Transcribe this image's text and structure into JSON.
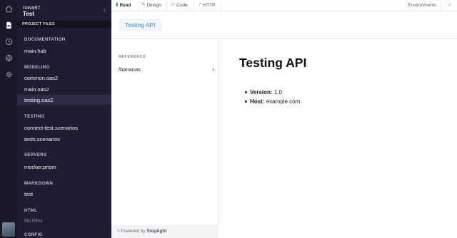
{
  "rail": {
    "icons": [
      "home-icon",
      "document-icon",
      "history-icon",
      "globe-icon",
      "settings-icon"
    ]
  },
  "project": {
    "user": "rowa97",
    "name": "Test",
    "files_header": "PROJECT FILES",
    "sections": [
      {
        "title": "DOCUMENTATION",
        "files": [
          "main.hub"
        ]
      },
      {
        "title": "MODELING",
        "files": [
          "common.oas2",
          "main.oas2",
          "testing.oas2"
        ]
      },
      {
        "title": "TESTING",
        "files": [
          "connect-test.scenarios",
          "tests.scenarios"
        ]
      },
      {
        "title": "SERVERS",
        "files": [
          "mocker.prism"
        ]
      },
      {
        "title": "MARKDOWN",
        "files": [
          "test"
        ]
      },
      {
        "title": "HTML",
        "files": [],
        "empty_text": "No Files"
      },
      {
        "title": "CONFIG",
        "files": []
      }
    ],
    "active_file": "testing.oas2"
  },
  "toolbar": {
    "tabs": [
      {
        "label": "Read",
        "icon": "book-icon",
        "color": "#3aa55c"
      },
      {
        "label": "Design",
        "icon": "pencil-icon",
        "color": "#8a4fc9"
      },
      {
        "label": "Code",
        "icon": "code-icon",
        "color": "#e08a2a"
      },
      {
        "label": "HTTP",
        "icon": "send-icon",
        "color": "#8a8a93"
      }
    ],
    "environments_label": "Environments"
  },
  "header": {
    "api_title": "Testing API"
  },
  "reference": {
    "label": "REFERENCE",
    "items": [
      "/bananas"
    ],
    "powered_prefix": "Powered by",
    "powered_brand": "Stoplight"
  },
  "document": {
    "title": "Testing API",
    "meta": [
      {
        "key": "Version:",
        "value": "1.0"
      },
      {
        "key": "Host:",
        "value": "example.com"
      }
    ]
  }
}
